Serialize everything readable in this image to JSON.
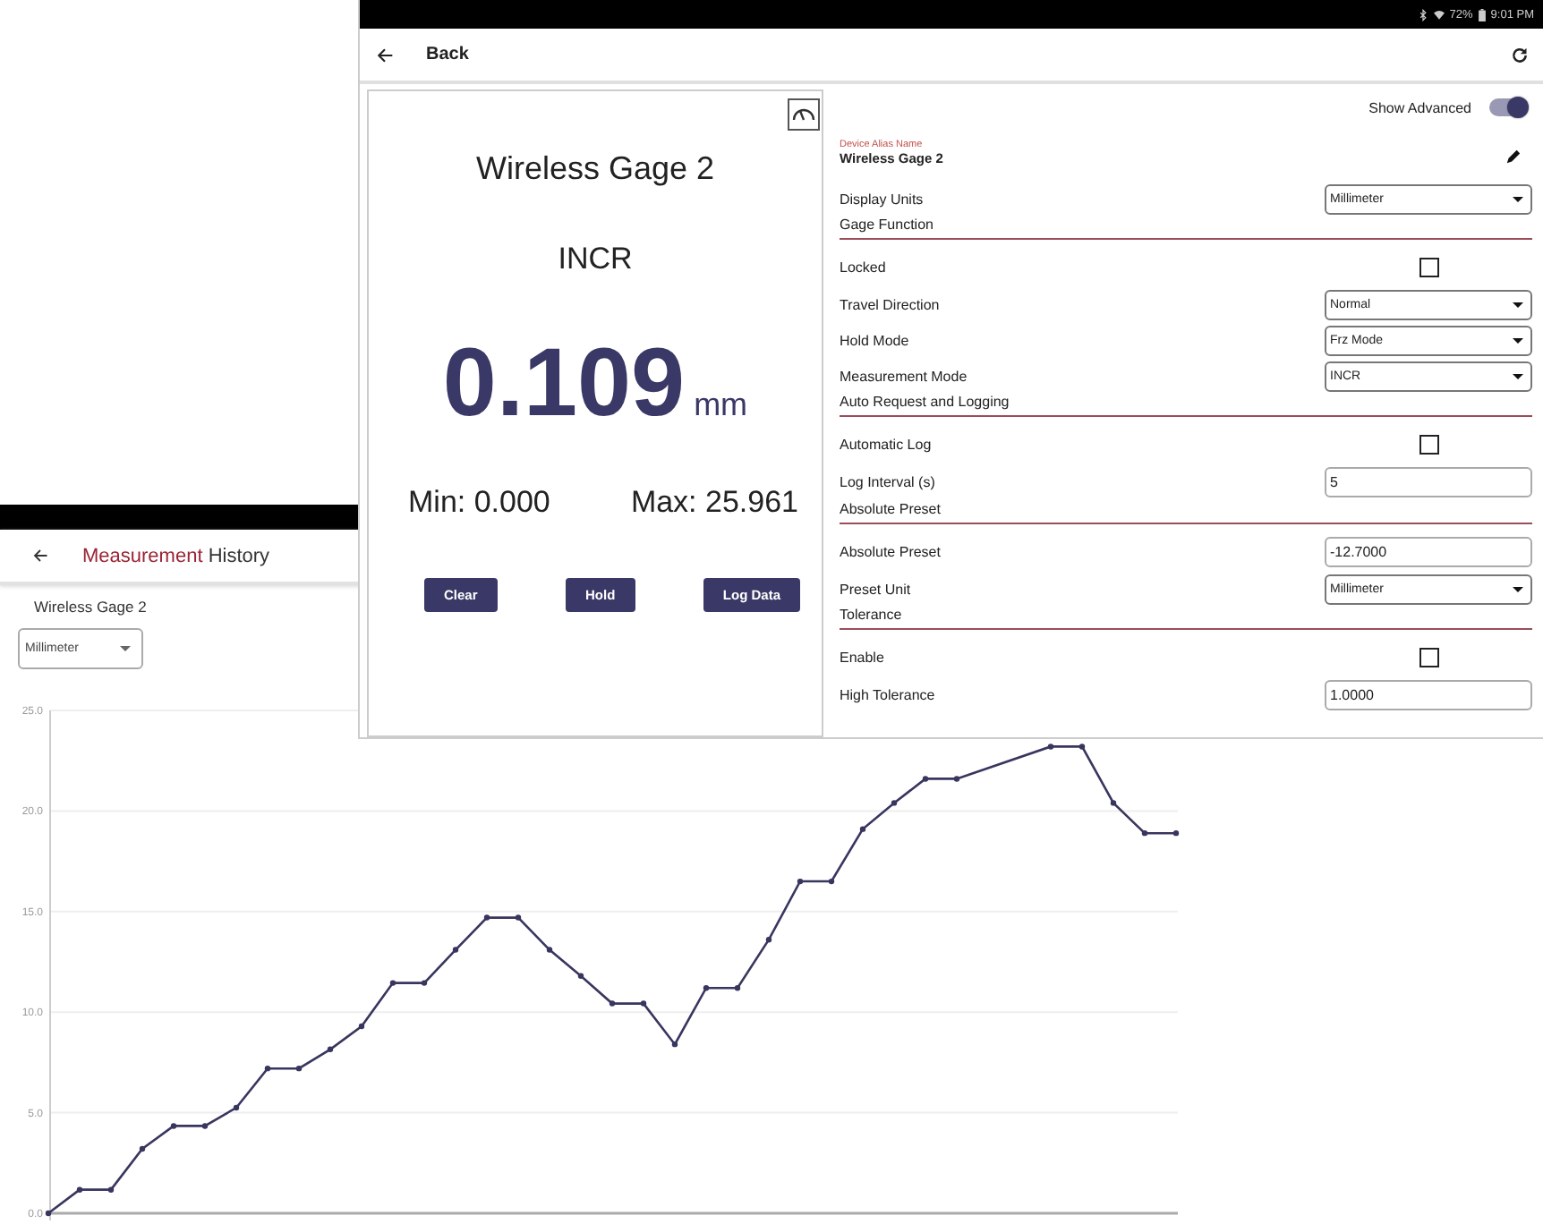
{
  "history_window": {
    "title_highlight": "Measurement",
    "title_rest": "History",
    "device": "Wireless Gage 2",
    "unit_select": {
      "value": "Millimeter"
    },
    "chart_data": {
      "type": "line",
      "grid": true,
      "categories": [
        null,
        null,
        null,
        null,
        null,
        null,
        null,
        null,
        null,
        null,
        null,
        null,
        null,
        null,
        null,
        null,
        null,
        null,
        null,
        null,
        null,
        null,
        null,
        null,
        null,
        null,
        null,
        null,
        null,
        null,
        null,
        null,
        null,
        null,
        null,
        null,
        null
      ],
      "yticks": [
        {
          "value": 0,
          "label": "0.0"
        },
        {
          "value": 5,
          "label": "5.0"
        },
        {
          "value": 10,
          "label": "10.0"
        },
        {
          "value": 15,
          "label": "15.0"
        },
        {
          "value": 20,
          "label": "20.0"
        },
        {
          "value": 25,
          "label": "25.0"
        }
      ],
      "ylim": [
        0,
        25
      ],
      "series": [
        {
          "color": "#38365e",
          "marker": true,
          "values": [
            0,
            1.17,
            1.17,
            3.2,
            4.34,
            4.34,
            5.25,
            7.2,
            7.2,
            8.15,
            9.3,
            11.45,
            11.45,
            13.1,
            14.7,
            14.7,
            13.1,
            11.8,
            10.43,
            10.43,
            8.4,
            11.2,
            11.2,
            13.6,
            16.5,
            16.5,
            19.1,
            20.4,
            21.6,
            21.6,
            null,
            null,
            23.2,
            23.2,
            20.4,
            18.9,
            18.9
          ]
        }
      ]
    }
  },
  "gage_window": {
    "status_bar": {
      "battery": "72%",
      "time": "9:01 PM"
    },
    "back_label": "Back",
    "display": {
      "name": "Wireless Gage 2",
      "mode": "INCR",
      "reading": "0.109",
      "unit": "mm",
      "min": "Min: 0.000",
      "max": "Max: 25.961",
      "buttons": [
        "Clear",
        "Hold",
        "Log Data"
      ]
    },
    "show_advanced": {
      "label": "Show Advanced",
      "on": true
    },
    "settings": [
      {
        "kind": "alias",
        "caption": "Device Alias Name",
        "value": "Wireless Gage 2"
      },
      {
        "kind": "select",
        "label": "Display Units",
        "value": "Millimeter"
      },
      {
        "kind": "section",
        "label": "Gage Function"
      },
      {
        "kind": "checkbox",
        "label": "Locked",
        "checked": false
      },
      {
        "kind": "select",
        "label": "Travel Direction",
        "value": "Normal"
      },
      {
        "kind": "select",
        "label": "Hold Mode",
        "value": "Frz Mode"
      },
      {
        "kind": "select",
        "label": "Measurement Mode",
        "value": "INCR"
      },
      {
        "kind": "section",
        "label": "Auto Request and Logging"
      },
      {
        "kind": "checkbox",
        "label": "Automatic Log",
        "checked": false
      },
      {
        "kind": "input",
        "label": "Log Interval (s)",
        "value": "5"
      },
      {
        "kind": "section",
        "label": "Absolute Preset"
      },
      {
        "kind": "input",
        "label": "Absolute Preset",
        "value": "-12.7000"
      },
      {
        "kind": "select",
        "label": "Preset Unit",
        "value": "Millimeter"
      },
      {
        "kind": "section",
        "label": "Tolerance"
      },
      {
        "kind": "checkbox",
        "label": "Enable",
        "checked": false
      },
      {
        "kind": "input",
        "label": "High Tolerance",
        "value": "1.0000"
      }
    ]
  }
}
